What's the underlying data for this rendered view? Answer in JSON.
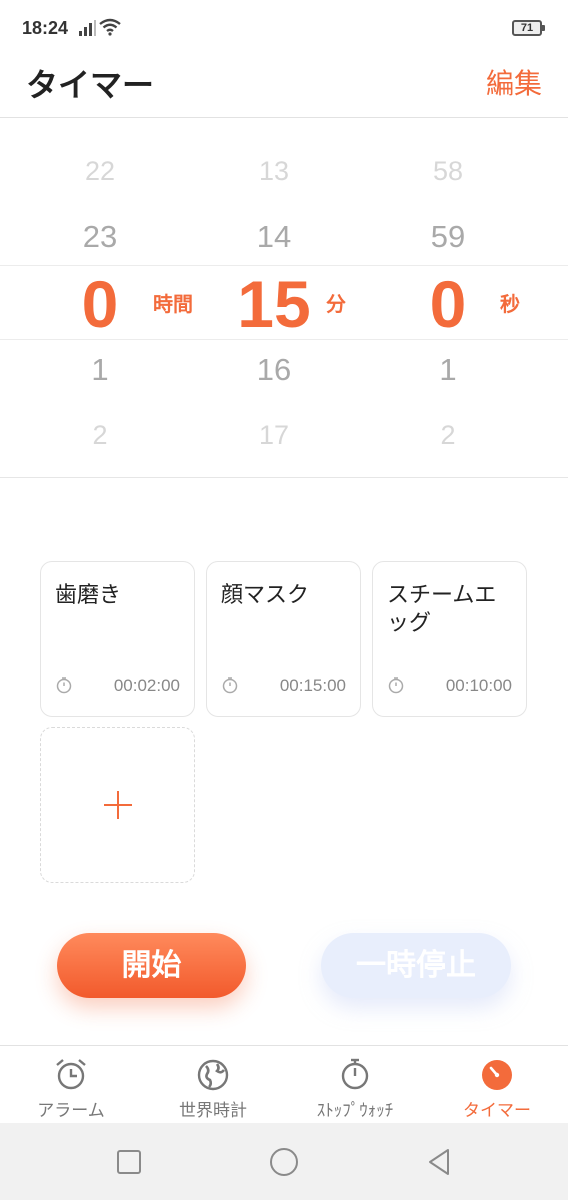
{
  "status_bar": {
    "time": "18:24",
    "battery": "71"
  },
  "header": {
    "title": "タイマー",
    "edit_label": "編集"
  },
  "picker": {
    "hours": {
      "far_above": "22",
      "above": "23",
      "selected": "0",
      "below": "1",
      "far_below": "2",
      "unit": "時間"
    },
    "minutes": {
      "far_above": "13",
      "above": "14",
      "selected": "15",
      "below": "16",
      "far_below": "17",
      "unit": "分"
    },
    "seconds": {
      "far_above": "58",
      "above": "59",
      "selected": "0",
      "below": "1",
      "far_below": "2",
      "unit": "秒"
    }
  },
  "presets": [
    {
      "name": "歯磨き",
      "time": "00:02:00"
    },
    {
      "name": "顔マスク",
      "time": "00:15:00"
    },
    {
      "name": "スチームエッグ",
      "time": "00:10:00"
    }
  ],
  "actions": {
    "start_label": "開始",
    "pause_label": "一時停止"
  },
  "tabs": [
    {
      "label": "アラーム",
      "icon": "alarm-clock-icon"
    },
    {
      "label": "世界時計",
      "icon": "globe-icon"
    },
    {
      "label": "ｽﾄｯﾌﾟｳｫｯﾁ",
      "icon": "stopwatch-icon"
    },
    {
      "label": "タイマー",
      "icon": "timer-icon",
      "active": true
    }
  ],
  "colors": {
    "accent": "#f36b3b",
    "inactive": "#777777",
    "pause_disabled": "#e8eefc"
  }
}
